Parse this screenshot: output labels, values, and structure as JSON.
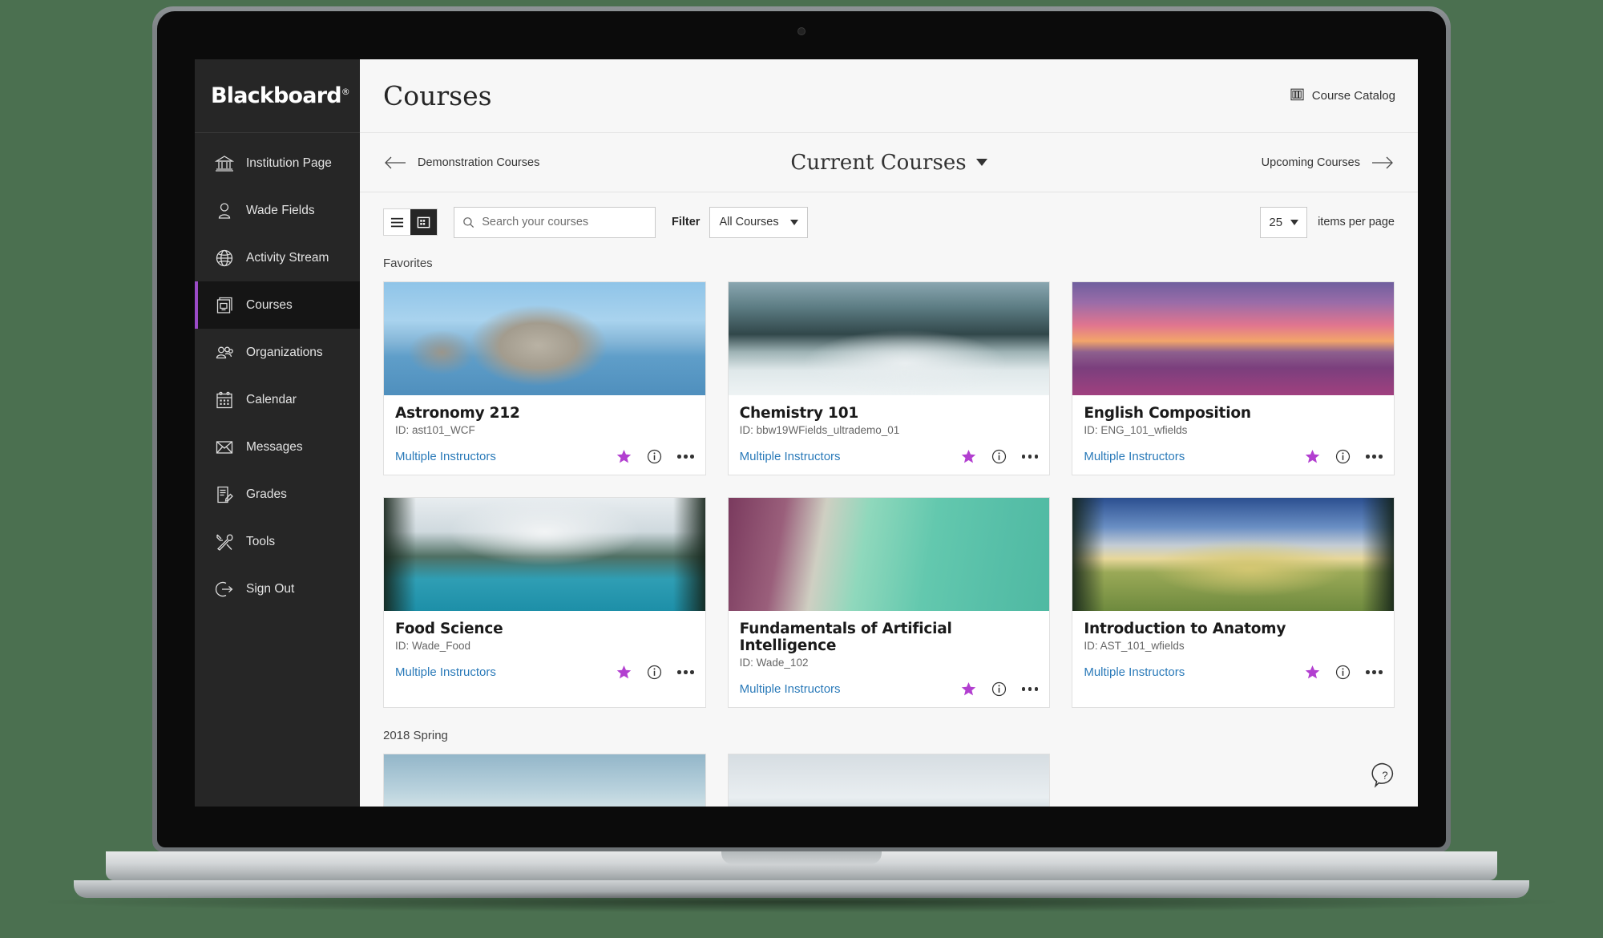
{
  "sidebar": {
    "brand": "Blackboard",
    "brand_mark": "®",
    "items": [
      {
        "label": "Institution Page",
        "icon": "institution-icon",
        "active": false
      },
      {
        "label": "Wade Fields",
        "icon": "person-icon",
        "active": false
      },
      {
        "label": "Activity Stream",
        "icon": "globe-icon",
        "active": false
      },
      {
        "label": "Courses",
        "icon": "courses-icon",
        "active": true
      },
      {
        "label": "Organizations",
        "icon": "organizations-icon",
        "active": false
      },
      {
        "label": "Calendar",
        "icon": "calendar-icon",
        "active": false
      },
      {
        "label": "Messages",
        "icon": "messages-icon",
        "active": false
      },
      {
        "label": "Grades",
        "icon": "grades-icon",
        "active": false
      },
      {
        "label": "Tools",
        "icon": "tools-icon",
        "active": false
      },
      {
        "label": "Sign Out",
        "icon": "sign-out-icon",
        "active": false
      }
    ],
    "active_accent": "#9b4bc7",
    "background": "#262626"
  },
  "header": {
    "title": "Courses",
    "course_catalog_label": "Course Catalog",
    "course_catalog_icon": "books-icon"
  },
  "term_nav": {
    "previous_label": "Demonstration Courses",
    "previous_icon": "arrow-left-icon",
    "current_label": "Current Courses",
    "current_caret_icon": "chevron-down-icon",
    "next_label": "Upcoming Courses",
    "next_icon": "arrow-right-icon"
  },
  "toolbar": {
    "list_view_icon": "list-view-icon",
    "grid_view_icon": "grid-view-icon",
    "active_view": "grid",
    "search_placeholder": "Search your courses",
    "search_value": "",
    "search_icon": "search-icon",
    "filter_label": "Filter",
    "filter_value": "All Courses",
    "filter_options": [
      "All Courses"
    ],
    "per_page_value": "25",
    "per_page_label": "items per page"
  },
  "groups": [
    {
      "title": "Favorites",
      "courses": [
        {
          "name": "Astronomy 212",
          "id_label": "ID: ast101_WCF",
          "instructors": "Multiple Instructors",
          "favorite": true,
          "thumb": "th-astronomy",
          "star_color": "#b23fd0"
        },
        {
          "name": "Chemistry 101",
          "id_label": "ID: bbw19WFields_ultrademo_01",
          "instructors": "Multiple Instructors",
          "favorite": true,
          "thumb": "th-chemistry",
          "star_color": "#b23fd0"
        },
        {
          "name": "English Composition",
          "id_label": "ID: ENG_101_wfields",
          "instructors": "Multiple Instructors",
          "favorite": true,
          "thumb": "th-english",
          "star_color": "#b23fd0"
        },
        {
          "name": "Food Science",
          "id_label": "ID: Wade_Food",
          "instructors": "Multiple Instructors",
          "favorite": true,
          "thumb": "th-food",
          "star_color": "#b23fd0"
        },
        {
          "name": "Fundamentals of Artificial Intelligence",
          "id_label": "ID: Wade_102",
          "instructors": "Multiple Instructors",
          "favorite": true,
          "thumb": "th-ai",
          "star_color": "#b23fd0"
        },
        {
          "name": "Introduction to Anatomy",
          "id_label": "ID: AST_101_wfields",
          "instructors": "Multiple Instructors",
          "favorite": true,
          "thumb": "th-anatomy",
          "star_color": "#b23fd0"
        }
      ]
    },
    {
      "title": "2018 Spring",
      "courses": [
        {
          "name": "",
          "id_label": "",
          "instructors": "",
          "favorite": false,
          "thumb": "th-spring1",
          "star_color": "#b23fd0"
        },
        {
          "name": "",
          "id_label": "",
          "instructors": "",
          "favorite": false,
          "thumb": "th-spring2",
          "star_color": "#b23fd0"
        }
      ]
    }
  ],
  "help": {
    "icon": "help-icon",
    "label": "?"
  },
  "colors": {
    "link_blue": "#2a7ab9",
    "accent_purple": "#9b4bc7",
    "star_purple": "#b23fd0",
    "page_bg": "#f7f7f7",
    "desktop_bg": "#4b7050"
  }
}
